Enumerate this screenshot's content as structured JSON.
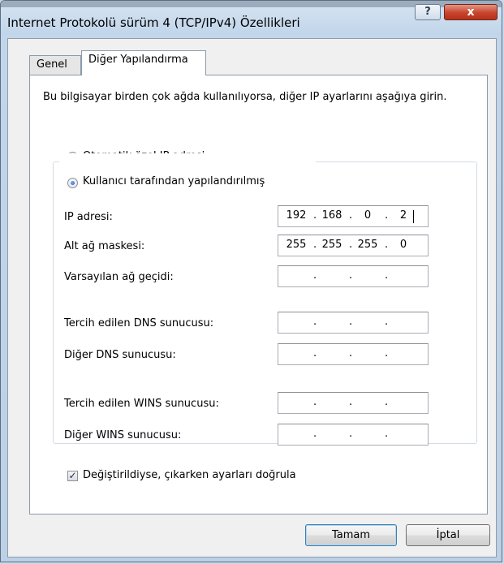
{
  "window": {
    "title": "Internet Protokolü sürüm 4 (TCP/IPv4) Özellikleri",
    "help_label": "?",
    "close_label": "x"
  },
  "tabs": [
    {
      "label": "Genel",
      "active": false
    },
    {
      "label": "Diğer Yapılandırma",
      "active": true
    }
  ],
  "panel": {
    "intro": "Bu bilgisayar birden çok ağda kullanılıyorsa, diğer IP ayarlarını aşağıya girin.",
    "radio_auto": {
      "label": "Otomatik özel IP adresi",
      "selected": false
    },
    "radio_user": {
      "label": "Kullanıcı tarafından yapılandırılmış",
      "selected": true
    },
    "fields": {
      "ip": {
        "label": "IP adresi:",
        "octets": [
          "192",
          "168",
          "0",
          "2"
        ]
      },
      "mask": {
        "label": "Alt ağ maskesi:",
        "octets": [
          "255",
          "255",
          "255",
          "0"
        ]
      },
      "gateway": {
        "label": "Varsayılan ağ geçidi:",
        "octets": [
          "",
          "",
          "",
          ""
        ]
      },
      "dns_pref": {
        "label": "Tercih edilen DNS sunucusu:",
        "octets": [
          "",
          "",
          "",
          ""
        ]
      },
      "dns_alt": {
        "label": "Diğer DNS sunucusu:",
        "octets": [
          "",
          "",
          "",
          ""
        ]
      },
      "wins_pref": {
        "label": "Tercih edilen WINS sunucusu:",
        "octets": [
          "",
          "",
          "",
          ""
        ]
      },
      "wins_alt": {
        "label": "Diğer WINS sunucusu:",
        "octets": [
          "",
          "",
          "",
          ""
        ]
      }
    },
    "validate": {
      "label": "Değiştirildiyse, çıkarken ayarları doğrula",
      "checked": true
    }
  },
  "buttons": {
    "ok": "Tamam",
    "cancel": "İptal"
  },
  "colors": {
    "titlebar": "#c2d6ea",
    "close": "#c7432c",
    "selection": "#1a55b6"
  }
}
